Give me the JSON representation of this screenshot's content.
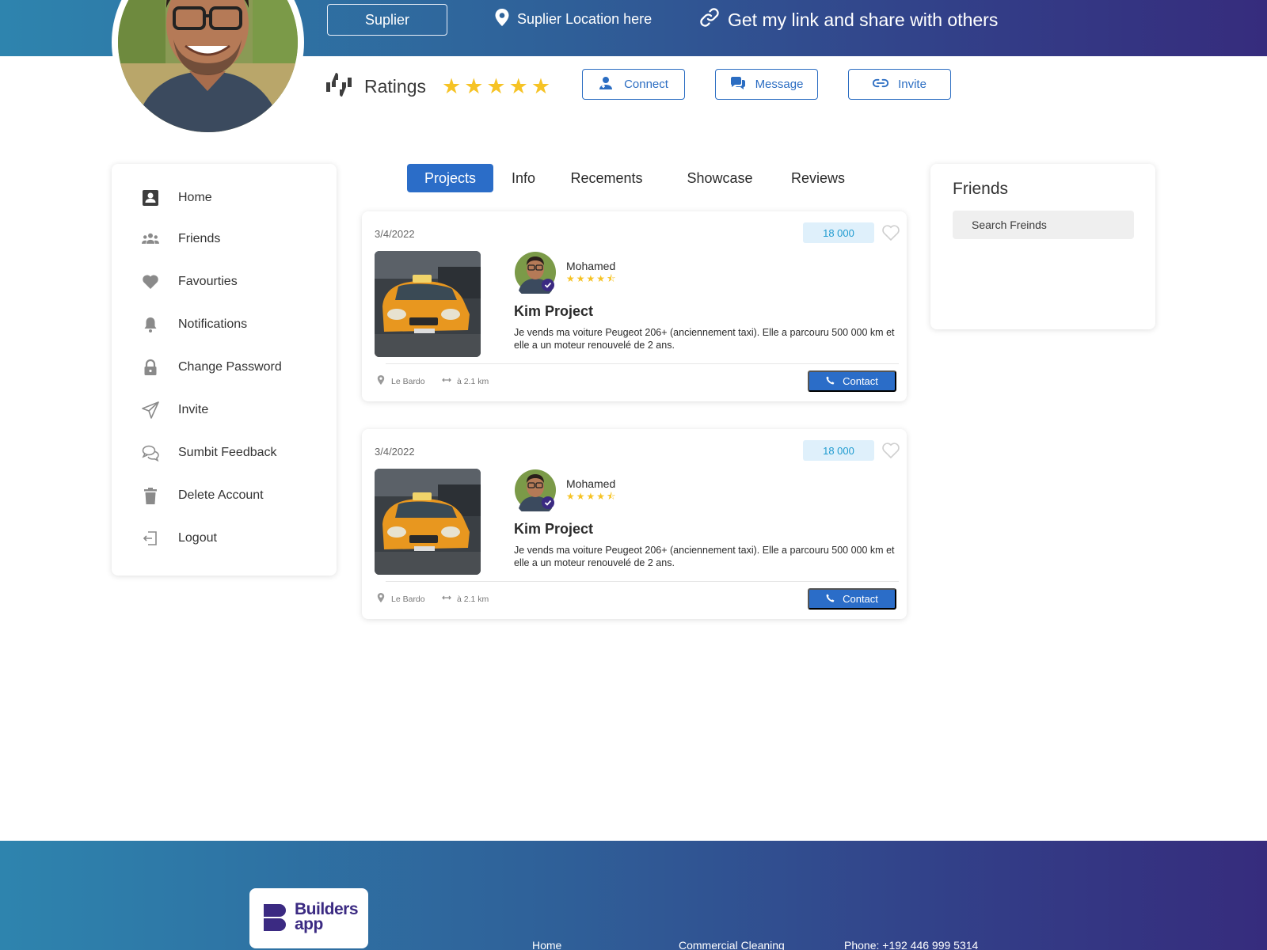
{
  "header": {
    "supplier_label": "Suplier",
    "location_text": "Suplier Location here",
    "share_text": "Get my link and share with others"
  },
  "profile": {
    "ratings_label": "Ratings",
    "rating_value": 5,
    "rating_max": 5,
    "actions": [
      {
        "label": "Connect",
        "icon": "user-plus-icon"
      },
      {
        "label": "Message",
        "icon": "chat-icon"
      },
      {
        "label": "Invite",
        "icon": "link-icon"
      }
    ]
  },
  "sidebar": {
    "items": [
      {
        "label": "Home",
        "icon": "contact-card-icon"
      },
      {
        "label": "Friends",
        "icon": "users-icon"
      },
      {
        "label": "Favourties",
        "icon": "heart-icon"
      },
      {
        "label": "Notifications",
        "icon": "bell-icon"
      },
      {
        "label": "Change Password",
        "icon": "lock-icon"
      },
      {
        "label": "Invite",
        "icon": "send-icon"
      },
      {
        "label": "Sumbit Feedback",
        "icon": "comments-icon"
      },
      {
        "label": "Delete Account",
        "icon": "trash-icon"
      },
      {
        "label": "Logout",
        "icon": "logout-icon"
      }
    ]
  },
  "tabs": [
    {
      "label": "Projects",
      "active": true
    },
    {
      "label": "Info",
      "active": false
    },
    {
      "label": "Recements",
      "active": false
    },
    {
      "label": "Showcase",
      "active": false
    },
    {
      "label": "Reviews",
      "active": false
    }
  ],
  "projects": [
    {
      "date": "3/4/2022",
      "price": "18 000",
      "owner": "Mohamed",
      "owner_rating": 4.5,
      "title": "Kim Project",
      "description": "Je vends ma voiture Peugeot 206+ (anciennement taxi). Elle a parcouru 500 000 km et elle a un moteur renouvelé de 2 ans.",
      "location": "Le Bardo",
      "distance": "à 2.1 km",
      "contact_label": "Contact"
    },
    {
      "date": "3/4/2022",
      "price": "18 000",
      "owner": "Mohamed",
      "owner_rating": 4.5,
      "title": "Kim Project",
      "description": "Je vends ma voiture Peugeot 206+ (anciennement taxi). Elle a parcouru 500 000 km et elle a un moteur renouvelé de 2 ans.",
      "location": "Le Bardo",
      "distance": "à 2.1 km",
      "contact_label": "Contact"
    }
  ],
  "friends": {
    "title": "Friends",
    "search_placeholder": "Search Freinds"
  },
  "footer": {
    "logo_line1": "Builders",
    "logo_line2": "app",
    "links": [
      "Home",
      "Commercial Cleaning",
      "Phone: +192 446 999 5314"
    ]
  },
  "colors": {
    "brand_gradient_start": "#2e84ae",
    "brand_gradient_end": "#362c7d",
    "primary": "#2b6dc8",
    "star": "#f6c325",
    "price_bg": "#dff0fb",
    "price_text": "#1f9bd0"
  }
}
